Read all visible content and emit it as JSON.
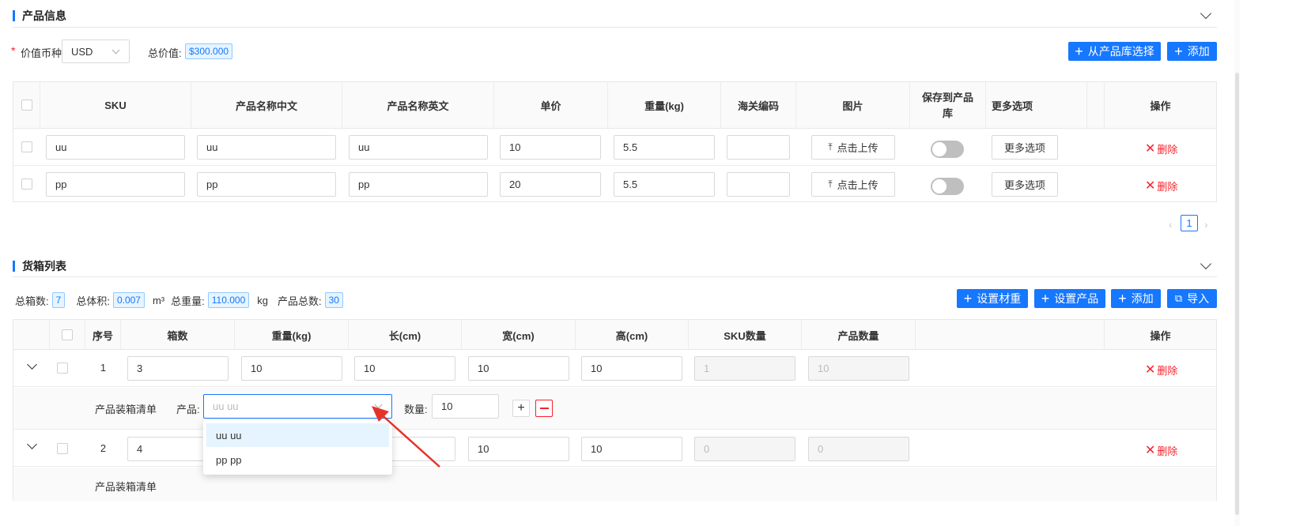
{
  "product_section": {
    "title": "产品信息",
    "currency_label": "价值币种",
    "currency_value": "USD",
    "total_value_label": "总价值:",
    "total_value": "$300.000",
    "btn_select_library": "从产品库选择",
    "btn_add": "添加",
    "columns": [
      "SKU",
      "产品名称中文",
      "产品名称英文",
      "单价",
      "重量(kg)",
      "海关编码",
      "图片",
      "保存到产品库",
      "更多选项",
      "操作"
    ],
    "rows": [
      {
        "sku": "uu",
        "name_cn": "uu",
        "name_en": "uu",
        "price": "10",
        "weight": "5.5",
        "customs": "",
        "upload": "点击上传",
        "more": "更多选项",
        "delete": "删除"
      },
      {
        "sku": "pp",
        "name_cn": "pp",
        "name_en": "pp",
        "price": "20",
        "weight": "5.5",
        "customs": "",
        "upload": "点击上传",
        "more": "更多选项",
        "delete": "删除"
      }
    ],
    "page": "1"
  },
  "box_section": {
    "title": "货箱列表",
    "total_boxes_label": "总箱数:",
    "total_boxes": "7",
    "total_volume_label": "总体积:",
    "total_volume": "0.007",
    "volume_unit": "m³",
    "total_weight_label": "总重量:",
    "total_weight": "110.000",
    "weight_unit": "kg",
    "total_products_label": "产品总数:",
    "total_products": "30",
    "btn_set_material_weight": "设置材重",
    "btn_set_product": "设置产品",
    "btn_add": "添加",
    "btn_import": "导入",
    "columns": [
      "序号",
      "箱数",
      "重量(kg)",
      "长(cm)",
      "宽(cm)",
      "高(cm)",
      "SKU数量",
      "产品数量",
      "操作"
    ],
    "rows": [
      {
        "index": "1",
        "boxes": "3",
        "weight": "10",
        "length": "10",
        "width": "10",
        "height": "10",
        "sku_qty": "1",
        "product_qty": "10",
        "delete": "删除"
      },
      {
        "index": "2",
        "boxes": "4",
        "weight": "",
        "length": "",
        "width": "10",
        "height": "10",
        "sku_qty": "0",
        "product_qty": "0",
        "delete": "删除"
      }
    ],
    "packing_label": "产品装箱清单",
    "product_label": "产品:",
    "product_placeholder": "uu uu",
    "quantity_label": "数量:",
    "quantity_value": "10",
    "dropdown_options": [
      "uu uu",
      "pp pp"
    ]
  },
  "colors": {
    "primary": "#1677ff",
    "danger": "#f5222d",
    "arrow": "#e5332a"
  }
}
